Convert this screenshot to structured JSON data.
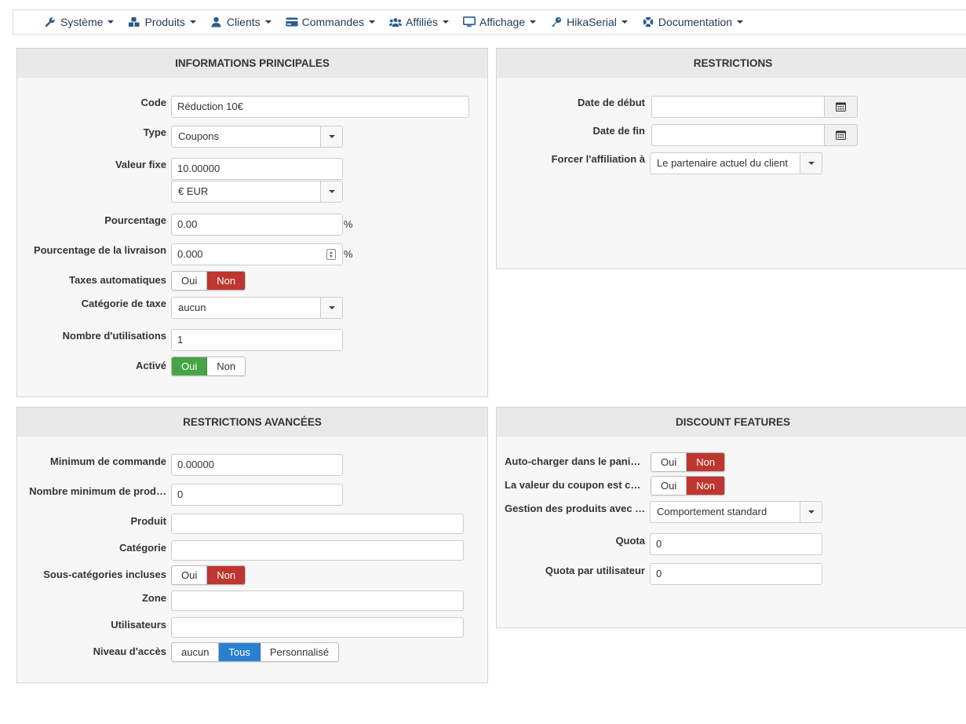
{
  "menu": [
    {
      "label": "Système",
      "icon": "wrench-icon"
    },
    {
      "label": "Produits",
      "icon": "cubes-icon"
    },
    {
      "label": "Clients",
      "icon": "user-icon"
    },
    {
      "label": "Commandes",
      "icon": "credit-card-icon"
    },
    {
      "label": "Affiliés",
      "icon": "users-icon"
    },
    {
      "label": "Affichage",
      "icon": "monitor-icon"
    },
    {
      "label": "HikaSerial",
      "icon": "key-icon"
    },
    {
      "label": "Documentation",
      "icon": "lifebuoy-icon"
    }
  ],
  "info": {
    "title": "INFORMATIONS PRINCIPALES",
    "code_label": "Code",
    "code_value": "Réduction 10€",
    "type_label": "Type",
    "type_value": "Coupons",
    "fixed_label": "Valeur fixe",
    "fixed_value": "10.00000",
    "currency_value": "€ EUR",
    "percent_label": "Pourcentage",
    "percent_value": "0.00",
    "percent_unit": "%",
    "shipping_percent_label": "Pourcentage de la livraison",
    "shipping_percent_value": "0.000",
    "shipping_percent_unit": "%",
    "auto_tax_label": "Taxes automatiques",
    "auto_tax_yes": "Oui",
    "auto_tax_no": "Non",
    "tax_cat_label": "Catégorie de taxe",
    "tax_cat_value": "aucun",
    "uses_label": "Nombre d'utilisations",
    "uses_value": "1",
    "active_label": "Activé",
    "active_yes": "Oui",
    "active_no": "Non"
  },
  "restrictions": {
    "title": "RESTRICTIONS",
    "start_label": "Date de début",
    "end_label": "Date de fin",
    "affiliate_label": "Forcer l'affiliation à",
    "affiliate_value": "Le partenaire actuel du client"
  },
  "advanced": {
    "title": "RESTRICTIONS AVANCÉES",
    "min_order_label": "Minimum de commande",
    "min_order_value": "0.00000",
    "min_products_label": "Nombre minimum de prod…",
    "min_products_value": "0",
    "product_label": "Produit",
    "category_label": "Catégorie",
    "subcats_label": "Sous-catégories incluses",
    "subcats_yes": "Oui",
    "subcats_no": "Non",
    "zone_label": "Zone",
    "users_label": "Utilisateurs",
    "access_label": "Niveau d'accès",
    "access_none": "aucun",
    "access_all": "Tous",
    "access_custom": "Personnalisé"
  },
  "discount": {
    "title": "DISCOUNT FEATURES",
    "autoload_label": "Auto-charger dans le pani…",
    "autoload_yes": "Oui",
    "autoload_no": "Non",
    "coupon_value_label": "La valeur du coupon est c…",
    "coupon_value_yes": "Oui",
    "coupon_value_no": "Non",
    "products_mgmt_label": "Gestion des produits avec …",
    "products_mgmt_value": "Comportement standard",
    "quota_label": "Quota",
    "quota_value": "0",
    "user_quota_label": "Quota par utilisateur",
    "user_quota_value": "0"
  },
  "colors": {
    "red": "#bd362f",
    "green": "#46a546",
    "blue": "#2a7fd0",
    "menu_text": "#1f3a58"
  }
}
